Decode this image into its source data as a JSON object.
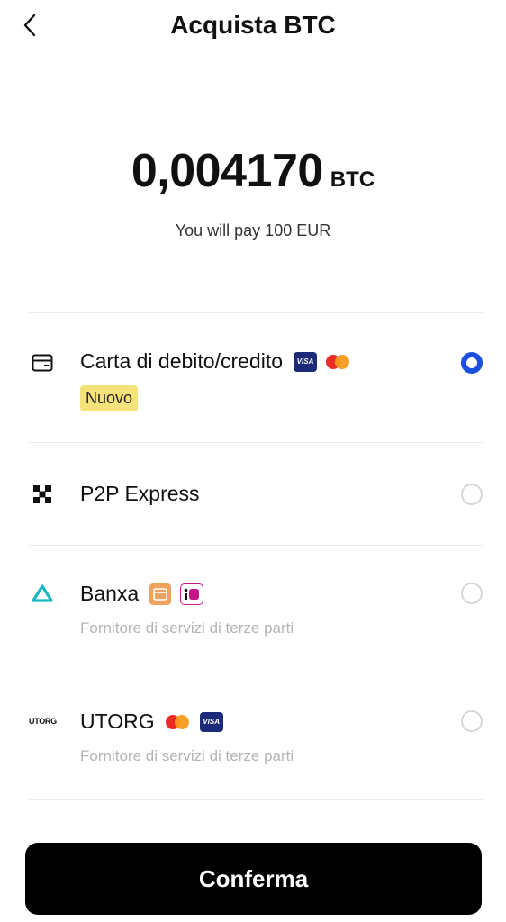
{
  "header": {
    "title": "Acquista BTC"
  },
  "amount": {
    "value": "0,004170",
    "unit": "BTC",
    "pay_text": "You will pay 100 EUR"
  },
  "methods": [
    {
      "title": "Carta di debito/credito",
      "badge": "Nuovo",
      "selected": true,
      "icon": "card-icon",
      "payment_icons": [
        "visa-icon",
        "mastercard-icon"
      ]
    },
    {
      "title": "P2P Express",
      "selected": false,
      "icon": "p2p-express-icon"
    },
    {
      "title": "Banxa",
      "subtitle": "Fornitore di servizi di terze parti",
      "selected": false,
      "icon": "banxa-logo-icon",
      "payment_icons": [
        "card-icon",
        "ideal-icon"
      ]
    },
    {
      "title": "UTORG",
      "subtitle": "Fornitore di servizi di terze parti",
      "logo_text": "UTORG",
      "selected": false,
      "payment_icons": [
        "mastercard-icon",
        "visa-icon"
      ]
    }
  ],
  "badges": {
    "visa": "VISA"
  },
  "colors": {
    "accent": "#1b4fe0",
    "badge_bg": "#f6e27a",
    "button_bg": "#000000",
    "subtitle": "#b4b4b4"
  },
  "confirm_button": {
    "label": "Conferma"
  }
}
